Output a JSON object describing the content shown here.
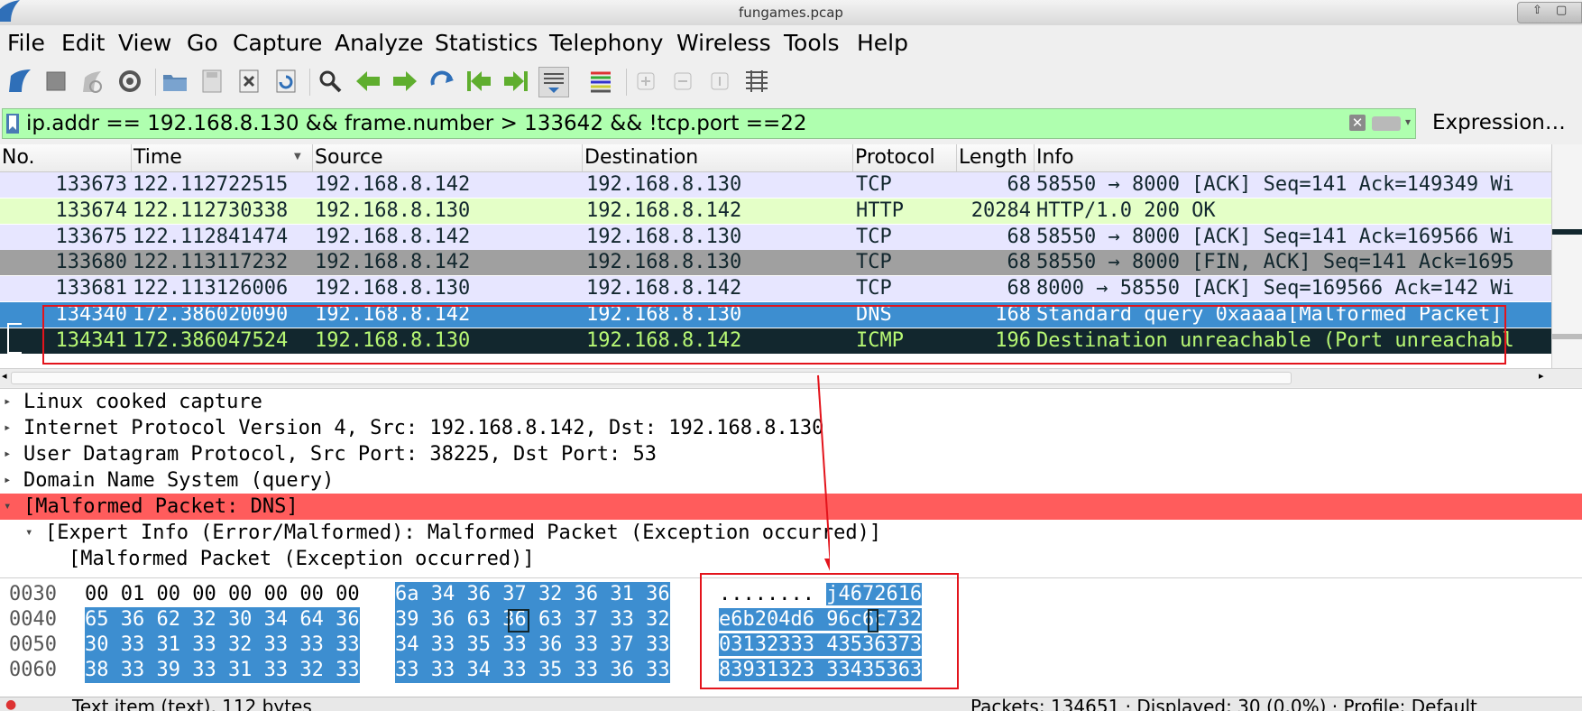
{
  "window": {
    "title": "fungames.pcap"
  },
  "menu": [
    "File",
    "Edit",
    "View",
    "Go",
    "Capture",
    "Analyze",
    "Statistics",
    "Telephony",
    "Wireless",
    "Tools",
    "Help"
  ],
  "toolbar": {
    "icons": [
      "shark-fin-start-icon",
      "stop-icon",
      "restart-icon",
      "options-gear-icon",
      "open-folder-icon",
      "save-file-icon",
      "close-file-icon",
      "reload-icon",
      "find-icon",
      "go-back-icon",
      "go-forward-icon",
      "go-to-packet-icon",
      "first-packet-icon",
      "last-packet-icon",
      "autoscroll-icon",
      "colorize-icon",
      "zoom-in-icon",
      "zoom-out-icon",
      "normal-size-icon",
      "resize-columns-icon"
    ]
  },
  "filter": {
    "value": "ip.addr == 192.168.8.130 && frame.number > 133642 && !tcp.port ==22",
    "expression_label": "Expression…",
    "bg_color": "#afffaf"
  },
  "packet_list": {
    "columns": [
      "No.",
      "Time",
      "Source",
      "Destination",
      "Protocol",
      "Length",
      "Info"
    ],
    "rows": [
      {
        "no": "133673",
        "time": "122.112722515",
        "src": "192.168.8.142",
        "dst": "192.168.8.130",
        "proto": "TCP",
        "len": "68",
        "info": "58550 → 8000 [ACK] Seq=141 Ack=149349 Wi",
        "bg": "#e7e6ff",
        "fg": "#12272e"
      },
      {
        "no": "133674",
        "time": "122.112730338",
        "src": "192.168.8.130",
        "dst": "192.168.8.142",
        "proto": "HTTP",
        "len": "20284",
        "info": "HTTP/1.0 200 OK",
        "bg": "#e4ffc7",
        "fg": "#12272e"
      },
      {
        "no": "133675",
        "time": "122.112841474",
        "src": "192.168.8.142",
        "dst": "192.168.8.130",
        "proto": "TCP",
        "len": "68",
        "info": "58550 → 8000 [ACK] Seq=141 Ack=169566 Wi",
        "bg": "#e7e6ff",
        "fg": "#12272e"
      },
      {
        "no": "133680",
        "time": "122.113117232",
        "src": "192.168.8.142",
        "dst": "192.168.8.130",
        "proto": "TCP",
        "len": "68",
        "info": "58550 → 8000 [FIN, ACK] Seq=141 Ack=1695",
        "bg": "#a0a0a0",
        "fg": "#12272e"
      },
      {
        "no": "133681",
        "time": "122.113126006",
        "src": "192.168.8.130",
        "dst": "192.168.8.142",
        "proto": "TCP",
        "len": "68",
        "info": "8000 → 58550 [ACK] Seq=169566 Ack=142 Wi",
        "bg": "#e7e6ff",
        "fg": "#12272e"
      },
      {
        "no": "134340",
        "time": "172.386020090",
        "src": "192.168.8.142",
        "dst": "192.168.8.130",
        "proto": "DNS",
        "len": "168",
        "info": "Standard query 0xaaaa[Malformed Packet]",
        "bg": "#3d8ed0",
        "fg": "#ffffff"
      },
      {
        "no": "134341",
        "time": "172.386047524",
        "src": "192.168.8.130",
        "dst": "192.168.8.142",
        "proto": "ICMP",
        "len": "196",
        "info": "Destination unreachable (Port unreachabl",
        "bg": "#12272e",
        "fg": "#b7f774"
      }
    ]
  },
  "details": [
    {
      "text": "Linux cooked capture",
      "expanded": false,
      "indent": 0
    },
    {
      "text": "Internet Protocol Version 4, Src: 192.168.8.142, Dst: 192.168.8.130",
      "expanded": false,
      "indent": 0
    },
    {
      "text": "User Datagram Protocol, Src Port: 38225, Dst Port: 53",
      "expanded": false,
      "indent": 0
    },
    {
      "text": "Domain Name System (query)",
      "expanded": false,
      "indent": 0
    },
    {
      "text": "[Malformed Packet: DNS]",
      "expanded": true,
      "indent": 0,
      "bg": "#ff5c5c"
    },
    {
      "text": "[Expert Info (Error/Malformed): Malformed Packet (Exception occurred)]",
      "expanded": true,
      "indent": 1
    },
    {
      "text": "[Malformed Packet (Exception occurred)]",
      "expanded": null,
      "indent": 2
    }
  ],
  "bytes": [
    {
      "off": "0030",
      "hex1": "00 01 00 00 00 00 00 00",
      "hex2": "6a 34 36 37 32 36 31 36",
      "ascii1": "........",
      "ascii2": "j4672616"
    },
    {
      "off": "0040",
      "hex1": "65 36 62 32 30 34 64 36",
      "hex2": "39 36 63 36 63 37 33 32",
      "ascii1": "e6b204d6",
      "ascii2": "96c6c732"
    },
    {
      "off": "0050",
      "hex1": "30 33 31 33 32 33 33 33",
      "hex2": "34 33 35 33 36 33 37 33",
      "ascii1": "03132333",
      "ascii2": "43536373"
    },
    {
      "off": "0060",
      "hex1": "38 33 39 33 31 33 32 33",
      "hex2": "33 33 34 33 35 33 36 33",
      "ascii1": "83931323",
      "ascii2": "33435363"
    }
  ],
  "status": {
    "left": "Text item (text), 112 bytes",
    "right": "Packets: 134651 · Displayed: 30 (0.0%) · Profile: Default"
  },
  "colors": {
    "selected_row": "#3d8ed0",
    "highlight_box": "#e3141c",
    "malformed": "#ff5c5c"
  }
}
